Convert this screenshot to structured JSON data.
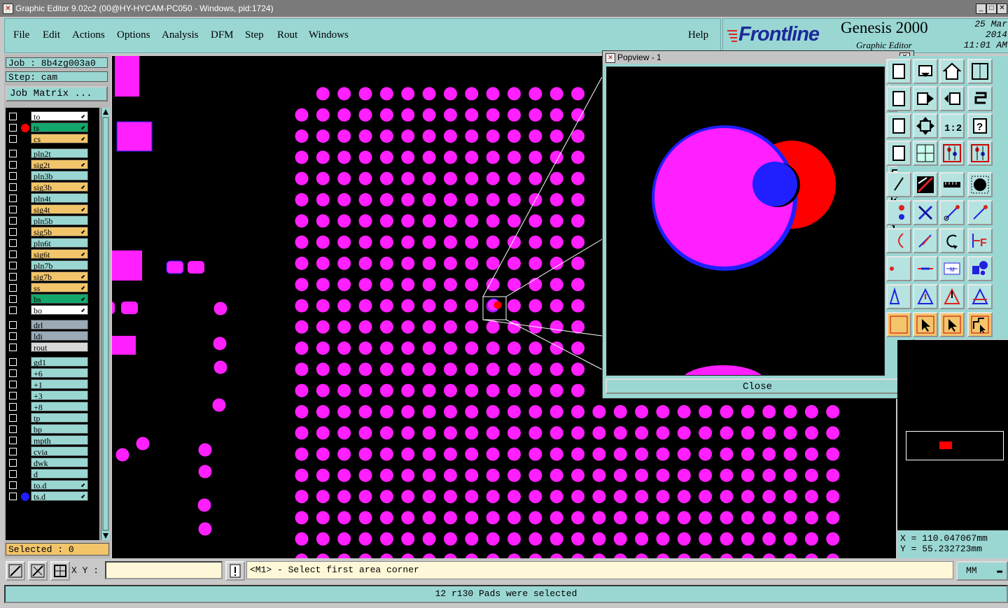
{
  "window": {
    "title": "Graphic Editor 9.02c2 (00@HY-HYCAM-PC050 - Windows, pid:1724)"
  },
  "menu": {
    "file": "File",
    "edit": "Edit",
    "actions": "Actions",
    "options": "Options",
    "analysis": "Analysis",
    "dfm": "DFM",
    "step": "Step",
    "rout": "Rout",
    "windows": "Windows",
    "help": "Help"
  },
  "brand": {
    "logo": "Frontline",
    "product": "Genesis 2000",
    "subtitle": "Graphic Editor",
    "date": "25 Mar 2014",
    "time": "11:01 AM"
  },
  "job": {
    "job_label": "Job : 8b4zg003a0",
    "step_label": "Step: cam",
    "matrix_button": "Job Matrix ..."
  },
  "layers": [
    {
      "name": "to",
      "color": "#ffffff",
      "mark": "arrow"
    },
    {
      "name": "ts",
      "color": "#14a76c",
      "mark": "arrow",
      "active": true
    },
    {
      "name": "cs",
      "color": "#f2c56a",
      "mark": "arrow"
    },
    {
      "name": "pln2t",
      "color": "#9ad7d3"
    },
    {
      "name": "sig2t",
      "color": "#f2c56a",
      "mark": "arrow"
    },
    {
      "name": "pln3b",
      "color": "#9ad7d3"
    },
    {
      "name": "sig3b",
      "color": "#f2c56a",
      "mark": "arrow"
    },
    {
      "name": "pln4t",
      "color": "#9ad7d3"
    },
    {
      "name": "sig4t",
      "color": "#f2c56a",
      "mark": "arrow"
    },
    {
      "name": "pln5b",
      "color": "#9ad7d3"
    },
    {
      "name": "sig5b",
      "color": "#f2c56a",
      "mark": "arrow"
    },
    {
      "name": "pln6t",
      "color": "#9ad7d3"
    },
    {
      "name": "sig6t",
      "color": "#f2c56a",
      "mark": "arrow"
    },
    {
      "name": "pln7b",
      "color": "#9ad7d3"
    },
    {
      "name": "sig7b",
      "color": "#f2c56a",
      "mark": "arrow"
    },
    {
      "name": "ss",
      "color": "#f2c56a",
      "mark": "arrow"
    },
    {
      "name": "bs",
      "color": "#14a76c",
      "mark": "arrow"
    },
    {
      "name": "bo",
      "color": "#ffffff",
      "mark": "arrow"
    },
    {
      "name": "drl",
      "color": "#9aaab6"
    },
    {
      "name": "ldi",
      "color": "#9aaab6"
    },
    {
      "name": "rout",
      "color": "#d8d8d8"
    },
    {
      "name": "gd1",
      "color": "#9ad7d3"
    },
    {
      "name": "+6",
      "color": "#9ad7d3"
    },
    {
      "name": "+1",
      "color": "#9ad7d3"
    },
    {
      "name": "+3",
      "color": "#9ad7d3"
    },
    {
      "name": "+8",
      "color": "#9ad7d3"
    },
    {
      "name": "tp",
      "color": "#9ad7d3"
    },
    {
      "name": "bp",
      "color": "#9ad7d3"
    },
    {
      "name": "mpth",
      "color": "#9ad7d3"
    },
    {
      "name": "cvia",
      "color": "#9ad7d3"
    },
    {
      "name": "dwk",
      "color": "#9ad7d3"
    },
    {
      "name": "d",
      "color": "#9ad7d3"
    },
    {
      "name": "to.d",
      "color": "#9ad7d3",
      "mark": "arrow"
    },
    {
      "name": "ts.d",
      "color": "#9ad7d3",
      "mark": "arrow"
    }
  ],
  "selected": "Selected : 0",
  "popview": {
    "title": "Popview - 1",
    "close_label": "Close"
  },
  "coords": {
    "x": "X = 110.047067mm",
    "y": "Y = 55.232723mm"
  },
  "command": {
    "xy_label": "X Y :",
    "xy_value": "",
    "prompt": "<M1> - Select first area corner",
    "units": "MM"
  },
  "status": "12 r130 Pads were selected",
  "colors": {
    "pad": "#ff1fff",
    "accent_panel": "#9ad7d3",
    "highlight": "#ff0000",
    "pad_outline": "#1f1fff"
  }
}
